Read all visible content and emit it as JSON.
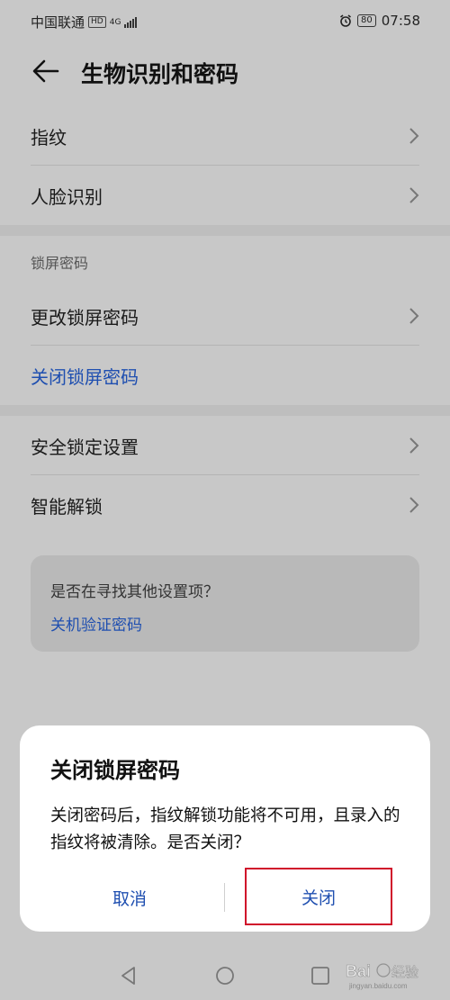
{
  "status_bar": {
    "carrier": "中国联通",
    "hd": "HD",
    "network": "4G",
    "battery": "80",
    "time": "07:58"
  },
  "header": {
    "title": "生物识别和密码"
  },
  "biometrics": {
    "items": [
      {
        "label": "指纹"
      },
      {
        "label": "人脸识别"
      }
    ]
  },
  "lock_screen": {
    "section_title": "锁屏密码",
    "change_label": "更改锁屏密码",
    "disable_label": "关闭锁屏密码"
  },
  "security": {
    "items": [
      {
        "label": "安全锁定设置"
      },
      {
        "label": "智能解锁"
      }
    ]
  },
  "suggestion": {
    "question": "是否在寻找其他设置项？",
    "link": "关机验证密码"
  },
  "dialog": {
    "title": "关闭锁屏密码",
    "message": "关闭密码后，指纹解锁功能将不可用，且录入的指纹将被清除。是否关闭？",
    "cancel_label": "取消",
    "confirm_label": "关闭"
  },
  "colors": {
    "accent": "#1f4fb0",
    "highlight_border": "#d0102a",
    "background_dimmed": "#c8c8c8"
  },
  "watermark": {
    "text": "Baidu经验",
    "subtext": "jingyan.baidu.com"
  }
}
